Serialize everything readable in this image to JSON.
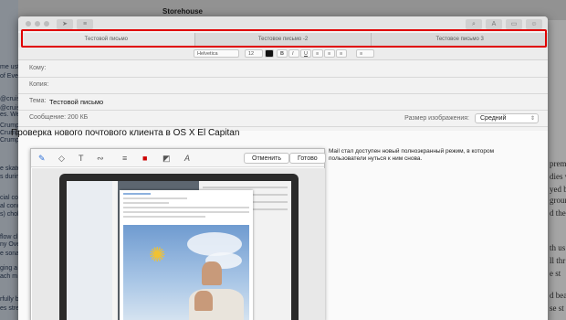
{
  "background": {
    "app_header": "Storehouse",
    "left_fragments": [
      "me ust",
      "of Ever",
      "@cruis",
      "@cruis",
      "es. We",
      "Crump",
      "Crump",
      "Crump",
      "e skate",
      "s durin",
      "cial co",
      "al conc",
      "s) chol",
      "flow cl",
      "ny Ove",
      "e sona",
      "ging a h",
      "ach m",
      "rfully b",
      "es stre"
    ],
    "right_fragments": [
      "prem",
      "dies w",
      "yed b",
      "groun",
      "d the",
      "th us",
      "ll thr",
      "e st",
      "d bea",
      "se st"
    ]
  },
  "window": {
    "tabs": [
      {
        "label": "Тестовой письмо",
        "active": true
      },
      {
        "label": "Тестовое письмо -2",
        "active": false
      },
      {
        "label": "Тестовое письмо 3",
        "active": false
      }
    ],
    "format_bar": {
      "font": "Helvetica",
      "size": "12",
      "bold": "B",
      "italic": "I",
      "underline": "U",
      "list": "≡"
    },
    "fields": {
      "to_label": "Кому:",
      "cc_label": "Копия:",
      "subject_label": "Тема:",
      "subject_value": "Тестовой письмо",
      "message_label": "Сообщение: 200 КБ",
      "image_size_label": "Размер изображения:",
      "image_size_value": "Средний"
    },
    "headline": "Проверка нового почтового клиента в OS X El Capitan",
    "body_text": "Mail стал доступен новый полноэкранный режим, в котором пользователи нуться к ним снова."
  },
  "markup": {
    "cancel": "Отменить",
    "done": "Готово",
    "tools": [
      "pen-icon",
      "shapes-icon",
      "text-icon",
      "signature-icon",
      "line-style-icon",
      "border-color-icon",
      "fill-color-icon",
      "font-icon"
    ]
  },
  "colors": {
    "highlight": "#e00000"
  }
}
